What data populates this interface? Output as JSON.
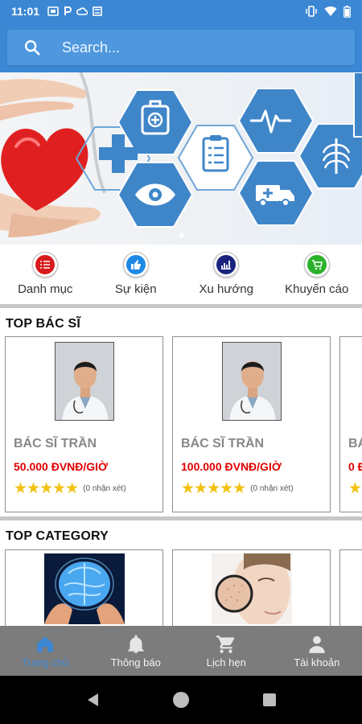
{
  "status_bar": {
    "time": "11:01",
    "notifications": [
      "SIM",
      "P",
      "cloud",
      "vpn"
    ]
  },
  "search": {
    "placeholder": "Search..."
  },
  "banner": {
    "slide_count": 2,
    "active_slide": 1
  },
  "quick_menu": [
    {
      "label": "Danh mục",
      "icon": "list-icon",
      "color": "#d81b1b"
    },
    {
      "label": "Sự kiện",
      "icon": "thumbs-up-icon",
      "color": "#1e88e5"
    },
    {
      "label": "Xu hướng",
      "icon": "bar-chart-icon",
      "color": "#1a237e"
    },
    {
      "label": "Khuyến cáo",
      "icon": "cart-icon",
      "color": "#2bb12b"
    }
  ],
  "top_doctors": {
    "title": "TOP BÁC SĨ",
    "items": [
      {
        "name": "BÁC SĨ TRẦN",
        "price": "50.000 ĐVNĐ/GIỜ",
        "stars": "★★★★★",
        "reviews": "(0 nhận xét)"
      },
      {
        "name": "BÁC SĨ TRẦN",
        "price": "100.000 ĐVNĐ/GIỜ",
        "stars": "★★★★★",
        "reviews": "(0 nhận xét)"
      },
      {
        "name": "BÁ",
        "price": "0 Đ",
        "stars": "★",
        "reviews": ""
      }
    ]
  },
  "top_category": {
    "title": "TOP CATEGORY",
    "items": [
      {
        "icon": "brain-icon"
      },
      {
        "icon": "skin-icon"
      },
      {
        "icon": "category-icon"
      }
    ]
  },
  "bottom_nav": [
    {
      "label": "Trang chủ",
      "icon": "home-icon",
      "active": true
    },
    {
      "label": "Thông báo",
      "icon": "bell-icon",
      "active": false
    },
    {
      "label": "Lịch hẹn",
      "icon": "cart-icon",
      "active": false
    },
    {
      "label": "Tài khoản",
      "icon": "person-icon",
      "active": false
    }
  ],
  "colors": {
    "primary": "#3b87d4",
    "price": "#e00000",
    "star": "#f2c10f",
    "nav_bg": "#7c7c7c"
  }
}
